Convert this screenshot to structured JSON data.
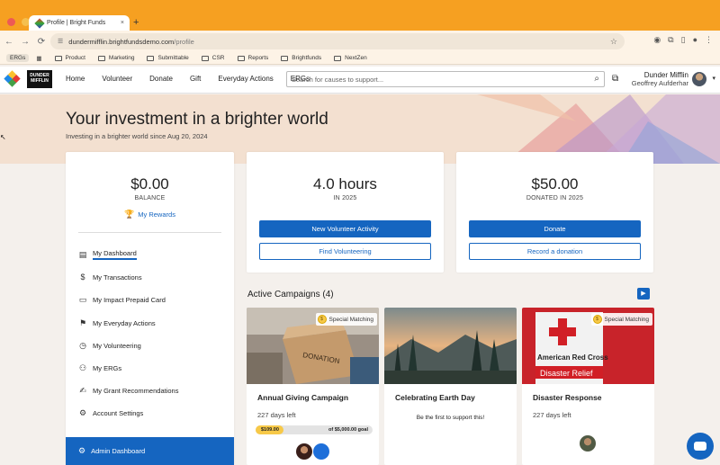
{
  "browser": {
    "tab_title": "Profile | Bright Funds",
    "tab_close": "×",
    "new_tab": "+",
    "url_domain": "dundermifflin.brightfundsdemo.com",
    "url_path": "/profile",
    "nav": {
      "back": "←",
      "forward": "→",
      "reload": "⟳"
    },
    "bookmarks": [
      "Product",
      "Marketing",
      "Submittable",
      "CSR",
      "Reports",
      "Brightfunds",
      "NextZen"
    ],
    "bookmark_ergs": "ERGs"
  },
  "header": {
    "logo_text": "DUNDER MIFFLIN",
    "nav": [
      "Home",
      "Volunteer",
      "Donate",
      "Gift",
      "Everyday Actions",
      "ERGs"
    ],
    "search_placeholder": "Search for causes to support...",
    "org": "Dunder Mifflin",
    "user": "Geoffrey Aufderhar"
  },
  "hero": {
    "title": "Your investment in a brighter world",
    "subtitle": "Investing in a brighter world since Aug 20, 2024"
  },
  "balance": {
    "amount": "$0.00",
    "label": "BALANCE",
    "rewards": "My Rewards"
  },
  "sidebar": {
    "items": [
      {
        "label": "My Dashboard",
        "icon": "📋",
        "name": "dashboard"
      },
      {
        "label": "My Transactions",
        "icon": "$",
        "name": "transactions"
      },
      {
        "label": "My Impact Prepaid Card",
        "icon": "▭",
        "name": "prepaid-card"
      },
      {
        "label": "My Everyday Actions",
        "icon": "⚑",
        "name": "everyday-actions"
      },
      {
        "label": "My Volunteering",
        "icon": "◷",
        "name": "volunteering"
      },
      {
        "label": "My ERGs",
        "icon": "👥",
        "name": "ergs"
      },
      {
        "label": "My Grant Recommendations",
        "icon": "✍",
        "name": "grant-recommendations"
      },
      {
        "label": "Account Settings",
        "icon": "⚙",
        "name": "account-settings"
      }
    ],
    "admin": "Admin Dashboard"
  },
  "volunteer": {
    "hours": "4.0 hours",
    "label": "IN 2025",
    "primary_btn": "New Volunteer Activity",
    "secondary_btn": "Find Volunteering"
  },
  "donated": {
    "amount": "$50.00",
    "label": "DONATED IN 2025",
    "primary_btn": "Donate",
    "secondary_btn": "Record a donation"
  },
  "campaigns": {
    "title": "Active Campaigns (4)",
    "items": [
      {
        "name": "Annual Giving Campaign",
        "days": "227 days left",
        "badge": "Special Matching",
        "raised": "$109.00",
        "goal": "of $5,000.00 goal",
        "progress": 0.022
      },
      {
        "name": "Celebrating Earth Day",
        "days": "",
        "note": "Be the first to support this!"
      },
      {
        "name": "Disaster Response",
        "days": "227 days left",
        "badge": "Special Matching"
      }
    ]
  },
  "colors": {
    "brand_blue": "#1565c0",
    "chrome_orange": "#f6a021",
    "gold": "#f7c948"
  }
}
